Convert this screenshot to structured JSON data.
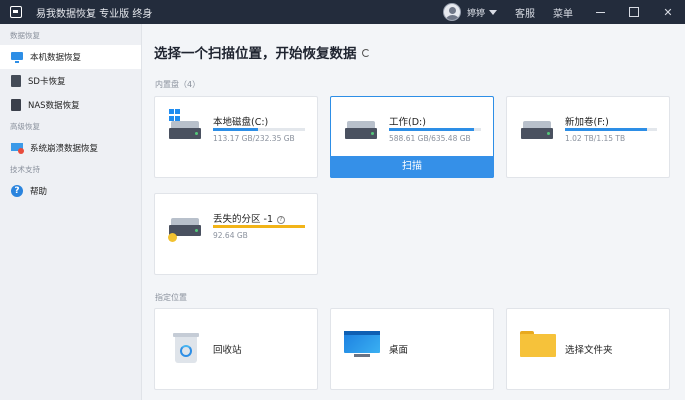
{
  "titlebar": {
    "app_title": "易我数据恢复 专业版 终身",
    "user_name": "婷婷",
    "links": [
      "客服",
      "菜单"
    ],
    "window_controls": [
      "minimize",
      "maximize",
      "close"
    ],
    "close_glyph": "✕"
  },
  "sidebar": {
    "sections": [
      {
        "title": "数据恢复",
        "items": [
          {
            "label": "本机数据恢复",
            "icon": "monitor-icon",
            "active": true
          },
          {
            "label": "SD卡恢复",
            "icon": "sd-card-icon"
          },
          {
            "label": "NAS数据恢复",
            "icon": "nas-icon"
          }
        ]
      },
      {
        "title": "高级恢复",
        "items": [
          {
            "label": "系统崩溃数据恢复",
            "icon": "system-crash-icon"
          }
        ]
      },
      {
        "title": "技术支持",
        "items": [
          {
            "label": "帮助",
            "icon": "help-icon",
            "glyph": "?"
          }
        ]
      }
    ]
  },
  "main": {
    "title": "选择一个扫描位置，开始恢复数据",
    "disks_section": "内置盘（4）",
    "disks": [
      {
        "name": "本地磁盘(C:)",
        "size": "113.17 GB/232.35 GB",
        "used_fraction": 0.487,
        "icon": "windows-disk-icon"
      },
      {
        "name": "工作(D:)",
        "size": "588.61 GB/635.48 GB",
        "used_fraction": 0.926,
        "icon": "disk-icon",
        "selected": true,
        "action": "扫描"
      },
      {
        "name": "新加卷(F:)",
        "size": "1.02 TB/1.15 TB",
        "used_fraction": 0.887,
        "icon": "disk-icon"
      },
      {
        "name": "丢失的分区 -1",
        "size": "92.64 GB",
        "used_fraction": 1.0,
        "icon": "lost-partition-icon",
        "help_glyph": "?"
      }
    ],
    "locations_section": "指定位置",
    "locations": [
      {
        "label": "回收站",
        "icon": "recycle-bin-icon"
      },
      {
        "label": "桌面",
        "icon": "desktop-icon"
      },
      {
        "label": "选择文件夹",
        "icon": "folder-icon"
      }
    ]
  },
  "colors": {
    "titlebar_bg": "#232c3c",
    "accent": "#2d8ee6",
    "warn_bar": "#f2b418"
  }
}
